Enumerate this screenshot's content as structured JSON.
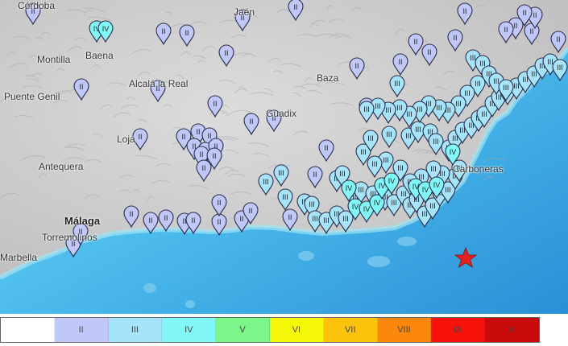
{
  "colors": {
    "land": "#cfcfcf",
    "sea_shallow": "#7fd6f0",
    "sea_mid": "#3fb2e6",
    "sea_deep": "#2a8fd6",
    "epicenter": "#e8211c"
  },
  "places": [
    {
      "id": "cordoba",
      "text": "Córdoba",
      "bold": false
    },
    {
      "id": "jaen",
      "text": "Jaén",
      "bold": false
    },
    {
      "id": "montilla",
      "text": "Montilla",
      "bold": false
    },
    {
      "id": "baena",
      "text": "Baena",
      "bold": false
    },
    {
      "id": "puente_genil",
      "text": "Puente Genil",
      "bold": false
    },
    {
      "id": "alcala",
      "text": "Alcalá la Real",
      "bold": false
    },
    {
      "id": "baza",
      "text": "Baza",
      "bold": false
    },
    {
      "id": "guadix",
      "text": "Guadix",
      "bold": false
    },
    {
      "id": "loja",
      "text": "Loja",
      "bold": false
    },
    {
      "id": "antequera",
      "text": "Antequera",
      "bold": false
    },
    {
      "id": "malaga",
      "text": "Málaga",
      "bold": true
    },
    {
      "id": "torremolinos",
      "text": "Torremolinos",
      "bold": false
    },
    {
      "id": "marbella",
      "text": "Marbella",
      "bold": false
    },
    {
      "id": "carboneras",
      "text": "Carboneras",
      "bold": false
    }
  ],
  "legend": {
    "items": [
      {
        "label": "",
        "color": "#ffffff"
      },
      {
        "label": "II",
        "color": "#bfc8f8"
      },
      {
        "label": "III",
        "color": "#a6e4fb"
      },
      {
        "label": "IV",
        "color": "#80f8f8"
      },
      {
        "label": "V",
        "color": "#7cf58a"
      },
      {
        "label": "VI",
        "color": "#f6f80a"
      },
      {
        "label": "VII",
        "color": "#fbc40a"
      },
      {
        "label": "VIII",
        "color": "#fb880c"
      },
      {
        "label": "IX",
        "color": "#f8120c"
      },
      {
        "label": "X",
        "color": "#c80a0a"
      }
    ]
  },
  "markers": [
    {
      "label": "II",
      "c": 1
    },
    {
      "label": "II",
      "c": 1
    },
    {
      "label": "II",
      "c": 1
    },
    {
      "label": "II",
      "c": 1
    },
    {
      "label": "II",
      "c": 1
    },
    {
      "label": "II",
      "c": 1
    },
    {
      "label": "II",
      "c": 1
    },
    {
      "label": "II",
      "c": 1
    },
    {
      "label": "II",
      "c": 1
    },
    {
      "label": "II",
      "c": 1
    },
    {
      "label": "II",
      "c": 1
    },
    {
      "label": "II",
      "c": 1
    },
    {
      "label": "II",
      "c": 1
    },
    {
      "label": "II",
      "c": 1
    },
    {
      "label": "II",
      "c": 1
    },
    {
      "label": "II",
      "c": 1
    },
    {
      "label": "II",
      "c": 1
    },
    {
      "label": "II",
      "c": 1
    },
    {
      "label": "II",
      "c": 1
    },
    {
      "label": "II",
      "c": 1
    },
    {
      "label": "II",
      "c": 1
    },
    {
      "label": "II",
      "c": 1
    },
    {
      "label": "II",
      "c": 1
    },
    {
      "label": "II",
      "c": 1
    },
    {
      "label": "II",
      "c": 1
    },
    {
      "label": "II",
      "c": 1
    },
    {
      "label": "II",
      "c": 1
    },
    {
      "label": "II",
      "c": 1
    },
    {
      "label": "II",
      "c": 1
    },
    {
      "label": "II",
      "c": 1
    },
    {
      "label": "II",
      "c": 1
    },
    {
      "label": "II",
      "c": 1
    },
    {
      "label": "II",
      "c": 1
    },
    {
      "label": "II",
      "c": 1
    },
    {
      "label": "II",
      "c": 1
    },
    {
      "label": "II",
      "c": 1
    },
    {
      "label": "II",
      "c": 1
    },
    {
      "label": "II",
      "c": 1
    },
    {
      "label": "II",
      "c": 1
    },
    {
      "label": "II",
      "c": 1
    },
    {
      "label": "II",
      "c": 1
    },
    {
      "label": "II",
      "c": 1
    },
    {
      "label": "II",
      "c": 1
    },
    {
      "label": "II",
      "c": 1
    },
    {
      "label": "II",
      "c": 1
    },
    {
      "label": "II",
      "c": 1
    },
    {
      "label": "II",
      "c": 1
    },
    {
      "label": "II",
      "c": 1
    },
    {
      "label": "III",
      "c": 2
    },
    {
      "label": "III",
      "c": 2
    },
    {
      "label": "III",
      "c": 2
    },
    {
      "label": "III",
      "c": 2
    },
    {
      "label": "III",
      "c": 2
    },
    {
      "label": "III",
      "c": 2
    },
    {
      "label": "III",
      "c": 2
    },
    {
      "label": "III",
      "c": 2
    },
    {
      "label": "III",
      "c": 2
    },
    {
      "label": "III",
      "c": 2
    },
    {
      "label": "III",
      "c": 2
    },
    {
      "label": "III",
      "c": 2
    },
    {
      "label": "III",
      "c": 2
    },
    {
      "label": "III",
      "c": 2
    },
    {
      "label": "III",
      "c": 2
    },
    {
      "label": "III",
      "c": 2
    },
    {
      "label": "III",
      "c": 2
    },
    {
      "label": "III",
      "c": 2
    },
    {
      "label": "III",
      "c": 2
    },
    {
      "label": "III",
      "c": 2
    },
    {
      "label": "III",
      "c": 2
    },
    {
      "label": "III",
      "c": 2
    },
    {
      "label": "III",
      "c": 2
    },
    {
      "label": "III",
      "c": 2
    },
    {
      "label": "III",
      "c": 2
    },
    {
      "label": "III",
      "c": 2
    },
    {
      "label": "III",
      "c": 2
    },
    {
      "label": "III",
      "c": 2
    },
    {
      "label": "III",
      "c": 2
    },
    {
      "label": "III",
      "c": 2
    },
    {
      "label": "III",
      "c": 2
    },
    {
      "label": "III",
      "c": 2
    },
    {
      "label": "III",
      "c": 2
    },
    {
      "label": "III",
      "c": 2
    },
    {
      "label": "III",
      "c": 2
    },
    {
      "label": "III",
      "c": 2
    },
    {
      "label": "III",
      "c": 2
    },
    {
      "label": "III",
      "c": 2
    },
    {
      "label": "III",
      "c": 2
    },
    {
      "label": "III",
      "c": 2
    },
    {
      "label": "III",
      "c": 2
    },
    {
      "label": "III",
      "c": 2
    },
    {
      "label": "III",
      "c": 2
    },
    {
      "label": "III",
      "c": 2
    },
    {
      "label": "III",
      "c": 2
    },
    {
      "label": "III",
      "c": 2
    },
    {
      "label": "III",
      "c": 2
    },
    {
      "label": "III",
      "c": 2
    },
    {
      "label": "III",
      "c": 2
    },
    {
      "label": "III",
      "c": 2
    },
    {
      "label": "III",
      "c": 2
    },
    {
      "label": "III",
      "c": 2
    },
    {
      "label": "III",
      "c": 2
    },
    {
      "label": "III",
      "c": 2
    },
    {
      "label": "III",
      "c": 2
    },
    {
      "label": "III",
      "c": 2
    },
    {
      "label": "III",
      "c": 2
    },
    {
      "label": "III",
      "c": 2
    },
    {
      "label": "III",
      "c": 2
    },
    {
      "label": "III",
      "c": 2
    },
    {
      "label": "III",
      "c": 2
    },
    {
      "label": "III",
      "c": 2
    },
    {
      "label": "III",
      "c": 2
    },
    {
      "label": "III",
      "c": 2
    },
    {
      "label": "III",
      "c": 2
    },
    {
      "label": "III",
      "c": 2
    },
    {
      "label": "III",
      "c": 2
    },
    {
      "label": "III",
      "c": 2
    },
    {
      "label": "III",
      "c": 2
    },
    {
      "label": "III",
      "c": 2
    },
    {
      "label": "III",
      "c": 2
    },
    {
      "label": "III",
      "c": 2
    },
    {
      "label": "IV",
      "c": 3
    },
    {
      "label": "IV",
      "c": 3
    },
    {
      "label": "IV",
      "c": 3
    },
    {
      "label": "IV",
      "c": 3
    },
    {
      "label": "IV",
      "c": 3
    },
    {
      "label": "IV",
      "c": 3
    },
    {
      "label": "IV",
      "c": 3
    },
    {
      "label": "IV",
      "c": 3
    },
    {
      "label": "IV",
      "c": 3
    },
    {
      "label": "IV",
      "c": 3
    },
    {
      "label": "IV",
      "c": 3
    },
    {
      "label": "IV",
      "c": 3
    }
  ]
}
